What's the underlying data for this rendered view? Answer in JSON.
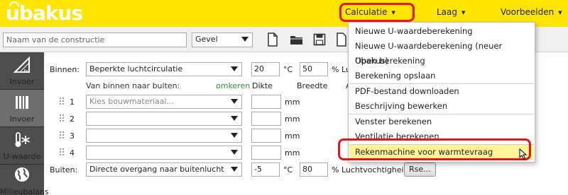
{
  "header": {
    "logo": "ubakus",
    "menus": [
      {
        "label": "Calculatie"
      },
      {
        "label": "Laag"
      },
      {
        "label": "Voorbeelden"
      }
    ],
    "background": "#ffe500"
  },
  "toolbar": {
    "name_placeholder": "Naam van de constructie",
    "type_select": "Gevel",
    "icons": [
      "new-document-icon",
      "open-folder-icon",
      "save-icon",
      "pdf-icon"
    ]
  },
  "sidebar": {
    "items": [
      {
        "label": "Invoer",
        "icon": "ruler-triangle-icon"
      },
      {
        "label": "Invoer",
        "icon": "layers-icon"
      },
      {
        "label": "U-waarde",
        "icon": "thermometer-snow-icon"
      },
      {
        "label": "Milieubalans",
        "icon": "globe-icon"
      }
    ]
  },
  "form": {
    "binnen_label": "Binnen:",
    "binnen_select": "Beperkte luchtcirculatie",
    "binnen_temp": "20",
    "temp_unit": "°C",
    "binnen_humidity": "50",
    "binnen_humidity_suffix": "% Lu",
    "layers_header": "Van binnen naar buiten:",
    "omkeren": "omkeren",
    "col_dikte": "Dikte",
    "col_breedte": "Breedte",
    "col_extra": "A",
    "unit_mm": "mm",
    "material_placeholder": "Kies bouwmateriaal...",
    "layers": [
      {
        "num": "1"
      },
      {
        "num": "2"
      },
      {
        "num": "3"
      },
      {
        "num": "4"
      }
    ],
    "buiten_label": "Buiten:",
    "buiten_select": "Directe overgang naar buitenlucht",
    "buiten_temp": "-5",
    "buiten_humidity": "80",
    "buiten_humidity_suffix": "% Luchtvochtigheid",
    "rse_button": "Rse..."
  },
  "dropdown": {
    "items": [
      {
        "label": "Nieuwe U-waardeberekening"
      },
      {
        "label": "Nieuwe U-waardeberekening (neuer Ubakus)"
      },
      {
        "label": "Open berekening"
      },
      {
        "label": "Berekening opslaan"
      },
      {
        "label": "PDF-bestand downloaden"
      },
      {
        "label": "Beschrijving bewerken"
      },
      {
        "label": "Venster berekenen"
      },
      {
        "label": "Ventilatie berekenen"
      },
      {
        "label": "Rekenmachine voor warmtevraag"
      }
    ],
    "highlighted_index": 8
  },
  "annotation_color": "#e8141c"
}
